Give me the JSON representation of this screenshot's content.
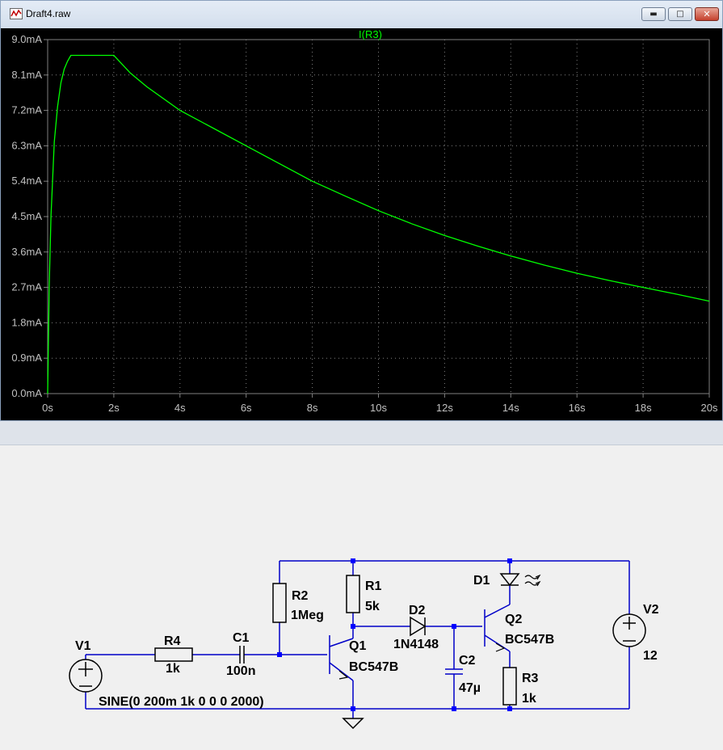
{
  "window": {
    "title": "Draft4.raw",
    "minimize_label": "▬",
    "maximize_label": "□",
    "close_label": "✕"
  },
  "chart_data": {
    "type": "line",
    "title": "I(R3)",
    "xlabel": "",
    "ylabel": "",
    "x_ticks": [
      "0s",
      "2s",
      "4s",
      "6s",
      "8s",
      "10s",
      "12s",
      "14s",
      "16s",
      "18s",
      "20s"
    ],
    "y_ticks": [
      "0.0mA",
      "0.9mA",
      "1.8mA",
      "2.7mA",
      "3.6mA",
      "4.5mA",
      "5.4mA",
      "6.3mA",
      "7.2mA",
      "8.1mA",
      "9.0mA"
    ],
    "xlim": [
      0,
      20
    ],
    "ylim": [
      0,
      9.0
    ],
    "x_unit": "s",
    "y_unit": "mA",
    "grid": true,
    "line_color": "#00ff00",
    "series": [
      {
        "name": "I(R3)",
        "x": [
          0,
          0.05,
          0.1,
          0.2,
          0.3,
          0.4,
          0.5,
          0.6,
          0.7,
          1.0,
          1.5,
          2.0,
          2.5,
          3,
          4,
          5,
          6,
          7,
          8,
          9,
          10,
          11,
          12,
          13,
          14,
          15,
          16,
          17,
          18,
          19,
          20
        ],
        "y": [
          0,
          2.8,
          4.5,
          6.4,
          7.3,
          7.9,
          8.25,
          8.45,
          8.6,
          8.6,
          8.6,
          8.6,
          8.15,
          7.8,
          7.2,
          6.75,
          6.3,
          5.85,
          5.4,
          5.02,
          4.65,
          4.32,
          4.02,
          3.75,
          3.5,
          3.27,
          3.06,
          2.87,
          2.7,
          2.53,
          2.35
        ]
      }
    ]
  },
  "schematic": {
    "wire_color": "#0000c8",
    "node_color": "#0000ff",
    "labels": {
      "v1_name": "V1",
      "v1_value": "SINE(0 200m 1k 0 0 0 2000)",
      "r4_name": "R4",
      "r4_value": "1k",
      "c1_name": "C1",
      "c1_value": "100n",
      "r2_name": "R2",
      "r2_value": "1Meg",
      "r1_name": "R1",
      "r1_value": "5k",
      "q1_name": "Q1",
      "q1_value": "BC547B",
      "d2_name": "D2",
      "d2_value": "1N4148",
      "c2_name": "C2",
      "c2_value": "47µ",
      "d1_name": "D1",
      "q2_name": "Q2",
      "q2_value": "BC547B",
      "r3_name": "R3",
      "r3_value": "1k",
      "v2_name": "V2",
      "v2_value": "12"
    }
  }
}
